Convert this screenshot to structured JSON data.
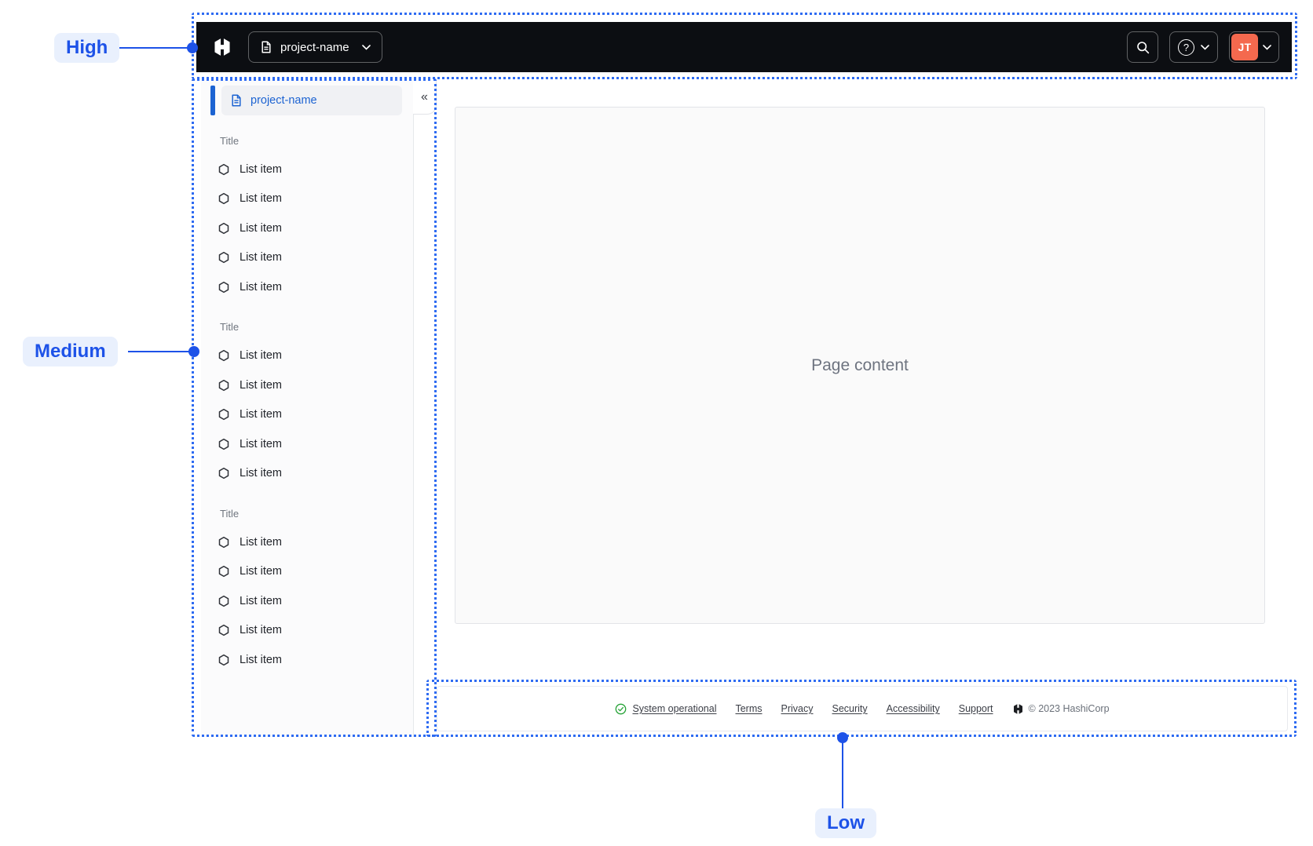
{
  "annotations": {
    "high": "High",
    "medium": "Medium",
    "low": "Low"
  },
  "navbar": {
    "project_switcher_label": "project-name",
    "help_icon_glyph": "?",
    "user_initials": "JT"
  },
  "sidebar": {
    "active_item_label": "project-name",
    "collapse_icon_glyph": "«",
    "sections": [
      {
        "title": "Title",
        "items": [
          "List item",
          "List item",
          "List item",
          "List item",
          "List item"
        ]
      },
      {
        "title": "Title",
        "items": [
          "List item",
          "List item",
          "List item",
          "List item",
          "List item"
        ]
      },
      {
        "title": "Title",
        "items": [
          "List item",
          "List item",
          "List item",
          "List item",
          "List item"
        ]
      }
    ]
  },
  "main": {
    "placeholder": "Page content"
  },
  "footer": {
    "status_label": "System operational",
    "links": [
      "Terms",
      "Privacy",
      "Security",
      "Accessibility",
      "Support"
    ],
    "copyright": "© 2023 HashiCorp"
  },
  "colors": {
    "annotation_blue": "#1d52e8",
    "dotted_border_blue": "#2e6bf2",
    "avatar_orange": "#f4694e",
    "active_blue": "#1c63d2",
    "status_green": "#27a338",
    "navbar_bg": "#0c0e12"
  }
}
